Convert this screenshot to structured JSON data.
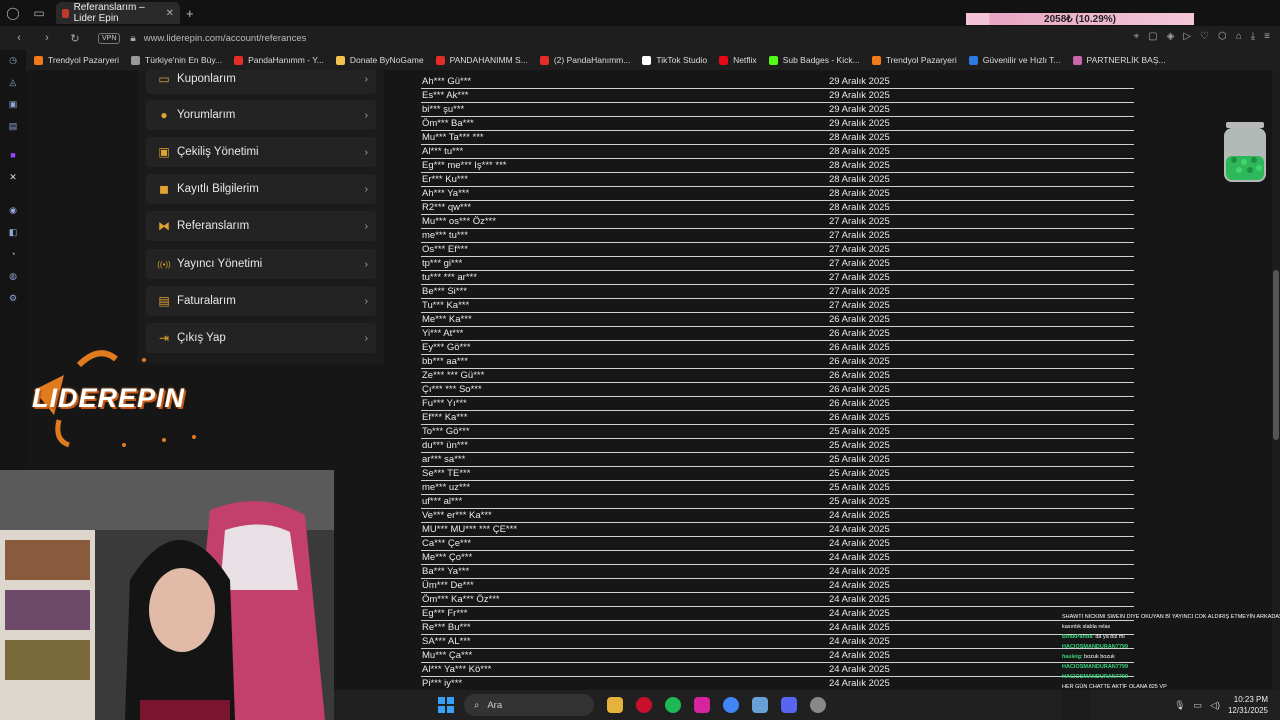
{
  "browser": {
    "tab_title": "Referanslarım – Lider Epin",
    "url": "www.liderepin.com/account/referances",
    "vpn_label": "VPN",
    "overlay_goal": "2058₺ (10.29%)",
    "overlay_goal_fraction": 0.1029
  },
  "bookmarks": [
    {
      "label": "Trendyol Pazaryeri",
      "color": "#f27a1a"
    },
    {
      "label": "Türkiye'nin En Büy...",
      "color": "#999999"
    },
    {
      "label": "PandaHanımm - Y...",
      "color": "#e52d27"
    },
    {
      "label": "Donate ByNoGame",
      "color": "#f2c14e"
    },
    {
      "label": "PANDAHANIMM S...",
      "color": "#e52d27"
    },
    {
      "label": "(2) PandaHanımm...",
      "color": "#e52d27"
    },
    {
      "label": "TikTok Studio",
      "color": "#ffffff"
    },
    {
      "label": "Netflix",
      "color": "#e50914"
    },
    {
      "label": "Sub Badges - Kick...",
      "color": "#53fc18"
    },
    {
      "label": "Trendyol Pazaryeri",
      "color": "#f27a1a"
    },
    {
      "label": "Güvenilir ve Hızlı T...",
      "color": "#2c7be5"
    },
    {
      "label": "PARTNERLİK BAŞ...",
      "color": "#cc66aa"
    }
  ],
  "menu": [
    {
      "label": "Kuponlarım",
      "icon": "ticket-icon"
    },
    {
      "label": "Yorumlarım",
      "icon": "comment-icon"
    },
    {
      "label": "Çekiliş Yönetimi",
      "icon": "gift-icon"
    },
    {
      "label": "Kayıtlı Bilgilerim",
      "icon": "save-icon"
    },
    {
      "label": "Referanslarım",
      "icon": "handshake-icon"
    },
    {
      "label": "Yayıncı Yönetimi",
      "icon": "broadcast-icon"
    },
    {
      "label": "Faturalarım",
      "icon": "invoice-icon"
    },
    {
      "label": "Çıkış Yap",
      "icon": "logout-icon"
    }
  ],
  "referrals": [
    {
      "name": "Ah*** Gü***",
      "date": "29 Aralık 2025"
    },
    {
      "name": "Es*** Ak***",
      "date": "29 Aralık 2025"
    },
    {
      "name": "bi*** şu***",
      "date": "29 Aralık 2025"
    },
    {
      "name": "Öm*** Ba***",
      "date": "29 Aralık 2025"
    },
    {
      "name": "Mu*** Ta*** ***",
      "date": "28 Aralık 2025"
    },
    {
      "name": "Al*** tu***",
      "date": "28 Aralık 2025"
    },
    {
      "name": "Eg*** me*** Iş*** ***",
      "date": "28 Aralık 2025"
    },
    {
      "name": "Er*** Ku***",
      "date": "28 Aralık 2025"
    },
    {
      "name": "Ah*** Ya***",
      "date": "28 Aralık 2025"
    },
    {
      "name": "R2*** qw***",
      "date": "28 Aralık 2025"
    },
    {
      "name": "Mu*** os*** Öz***",
      "date": "27 Aralık 2025"
    },
    {
      "name": "me*** tu***",
      "date": "27 Aralık 2025"
    },
    {
      "name": "Os*** Ef***",
      "date": "27 Aralık 2025"
    },
    {
      "name": "tp*** gi***",
      "date": "27 Aralık 2025"
    },
    {
      "name": "tu*** *** ar***",
      "date": "27 Aralık 2025"
    },
    {
      "name": "Be*** Si***",
      "date": "27 Aralık 2025"
    },
    {
      "name": "Tu*** Ka***",
      "date": "27 Aralık 2025"
    },
    {
      "name": "Me*** Ka***",
      "date": "26 Aralık 2025"
    },
    {
      "name": "Yi*** At***",
      "date": "26 Aralık 2025"
    },
    {
      "name": "Ey*** Gö***",
      "date": "26 Aralık 2025"
    },
    {
      "name": "bb*** aa***",
      "date": "26 Aralık 2025"
    },
    {
      "name": "Ze*** *** Gü***",
      "date": "26 Aralık 2025"
    },
    {
      "name": "Çı*** *** So***",
      "date": "26 Aralık 2025"
    },
    {
      "name": "Fu*** Yı***",
      "date": "26 Aralık 2025"
    },
    {
      "name": "Ef*** Ka***",
      "date": "26 Aralık 2025"
    },
    {
      "name": "To*** Gö***",
      "date": "25 Aralık 2025"
    },
    {
      "name": "du*** ün***",
      "date": "25 Aralık 2025"
    },
    {
      "name": "ar*** sa***",
      "date": "25 Aralık 2025"
    },
    {
      "name": "Se*** TE***",
      "date": "25 Aralık 2025"
    },
    {
      "name": "me*** uz***",
      "date": "25 Aralık 2025"
    },
    {
      "name": "uf*** al***",
      "date": "25 Aralık 2025"
    },
    {
      "name": "Ve*** er*** Ka***",
      "date": "24 Aralık 2025"
    },
    {
      "name": "MU*** MU*** *** ÇE***",
      "date": "24 Aralık 2025"
    },
    {
      "name": "Ca*** Çe***",
      "date": "24 Aralık 2025"
    },
    {
      "name": "Me*** Ço***",
      "date": "24 Aralık 2025"
    },
    {
      "name": "Ba*** Ya***",
      "date": "24 Aralık 2025"
    },
    {
      "name": "Üm*** De***",
      "date": "24 Aralık 2025"
    },
    {
      "name": "Öm*** Ka*** Öz***",
      "date": "24 Aralık 2025"
    },
    {
      "name": "Eg*** Fr***",
      "date": "24 Aralık 2025"
    },
    {
      "name": "Re*** Bu***",
      "date": "24 Aralık 2025"
    },
    {
      "name": "SA*** AL***",
      "date": "24 Aralık 2025"
    },
    {
      "name": "Mu*** Ça***",
      "date": "24 Aralık 2025"
    },
    {
      "name": "Al*** Ya*** Kö***",
      "date": "24 Aralık 2025"
    },
    {
      "name": "Pi*** iy***",
      "date": "24 Aralık 2025"
    }
  ],
  "logo_text": "LIDEREPIN",
  "chat": [
    {
      "user": "",
      "text": "SHAWTI NICKIMI SWEIN DIYE OKUYAN Bİ YAYINCI COK ALDIRIŞ ETMEYİN ARKADAŞLAR İSMİNİZ DEĞİŞEBİLİR"
    },
    {
      "user": "",
      "text": "kasıntık slabla relax"
    },
    {
      "user": "BirakPanda",
      "text": "da ya biz mi"
    },
    {
      "user": "HACIOSMANDURAN7799",
      "text": ""
    },
    {
      "user": "hasleig",
      "text": "bozuk bozuk"
    },
    {
      "user": "HACIOSMANDURAN7799",
      "text": ""
    },
    {
      "user": "HACIOSMANDURAN7799",
      "text": ""
    },
    {
      "user": "",
      "text": "HER GÜN CHATTE AKTİF OLANA 825 VP"
    }
  ],
  "taskbar": {
    "search_label": "Ara",
    "time": "10:23 PM",
    "date": "12/31/2025"
  }
}
